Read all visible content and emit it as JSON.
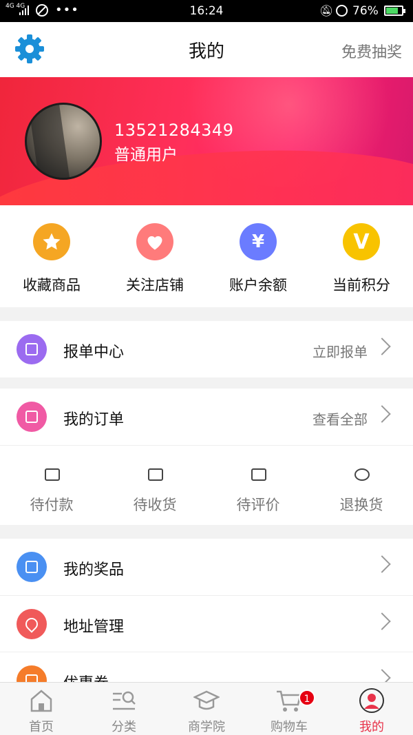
{
  "status_bar": {
    "network": "4G 4G",
    "dots": "•••",
    "time": "16:24",
    "battery_percent": "76%",
    "battery_level": 0.76
  },
  "header": {
    "title": "我的",
    "lottery_label": "免费抽奖"
  },
  "profile": {
    "phone": "13521284349",
    "level": "普通用户"
  },
  "shortcuts": [
    {
      "label": "收藏商品",
      "icon": "star-icon",
      "color": "#f5a623"
    },
    {
      "label": "关注店铺",
      "icon": "heart-icon",
      "color": "#ff7b7b"
    },
    {
      "label": "账户余额",
      "icon": "yen-icon",
      "glyph": "¥",
      "color": "#6b7cff"
    },
    {
      "label": "当前积分",
      "icon": "points-icon",
      "glyph": "V",
      "color": "#f8c300"
    }
  ],
  "report_center": {
    "label": "报单中心",
    "action": "立即报单",
    "color": "#9b6bf0"
  },
  "my_orders": {
    "label": "我的订单",
    "action": "查看全部",
    "color": "#f05aa4"
  },
  "order_status": [
    {
      "label": "待付款",
      "icon": "wallet-icon"
    },
    {
      "label": "待收货",
      "icon": "truck-icon"
    },
    {
      "label": "待评价",
      "icon": "comment-icon"
    },
    {
      "label": "退换货",
      "icon": "refund-icon"
    }
  ],
  "menu": [
    {
      "label": "我的奖品",
      "icon": "gift-icon",
      "color": "#4a90f2"
    },
    {
      "label": "地址管理",
      "icon": "location-icon",
      "color": "#f05a5a"
    },
    {
      "label": "优惠卷",
      "icon": "coupon-icon",
      "color": "#f57c2a"
    }
  ],
  "tabbar": [
    {
      "label": "首页",
      "icon": "home-icon"
    },
    {
      "label": "分类",
      "icon": "category-icon"
    },
    {
      "label": "商学院",
      "icon": "graduation-cap-icon"
    },
    {
      "label": "购物车",
      "icon": "cart-icon",
      "badge": "1"
    },
    {
      "label": "我的",
      "icon": "user-icon",
      "active": true
    }
  ],
  "colors": {
    "accent": "#e8334a",
    "settings": "#1a8fd8"
  }
}
